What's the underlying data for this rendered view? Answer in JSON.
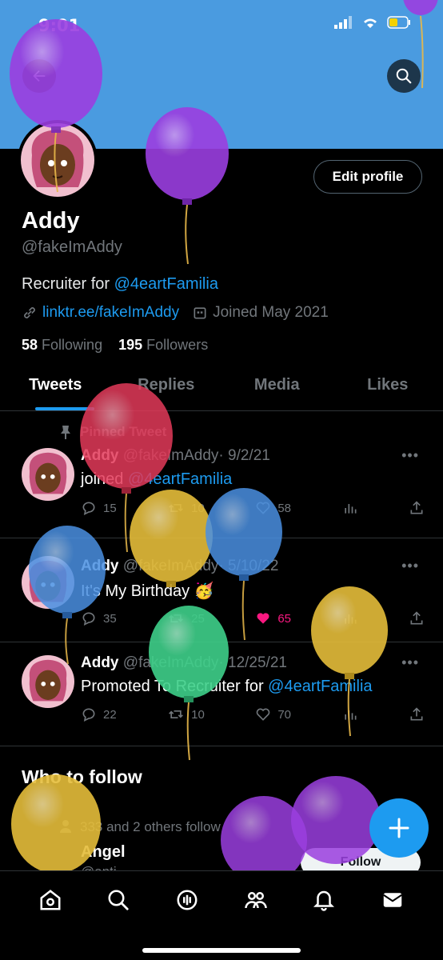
{
  "status": {
    "time": "9:01"
  },
  "header": {
    "back_icon": "arrow-left-icon",
    "search_icon": "search-icon"
  },
  "profile": {
    "name": "Addy",
    "handle": "@fakeImAddy",
    "bio_prefix": "Recruiter for ",
    "bio_mention": "@4eartFamilia",
    "link": "linktr.ee/fakeImAddy",
    "joined": "Joined May 2021",
    "following_count": "58",
    "following_label": "Following",
    "followers_count": "195",
    "followers_label": "Followers",
    "edit_label": "Edit profile"
  },
  "tabs": [
    {
      "label": "Tweets"
    },
    {
      "label": "Replies"
    },
    {
      "label": "Media"
    },
    {
      "label": "Likes"
    }
  ],
  "pinned_label": "Pinned Tweet",
  "tweets": [
    {
      "name": "Addy",
      "handle": "@fakeImAddy",
      "date": "· 9/2/21",
      "text_prefix": "joined ",
      "mention": "@4eartFamilia",
      "replies": "15",
      "retweets": "10",
      "likes": "58",
      "liked": false
    },
    {
      "name": "Addy",
      "handle": "@fakeImAddy",
      "date": "· 5/10/22",
      "text_prefix": "It's My Birthday 🥳",
      "mention": "",
      "replies": "35",
      "retweets": "25",
      "likes": "65",
      "liked": true
    },
    {
      "name": "Addy",
      "handle": "@fakeImAddy",
      "date": "· 12/25/21",
      "text_prefix": "Promoted To Recruiter for ",
      "mention": "@4eartFamilia",
      "replies": "22",
      "retweets": "10",
      "likes": "70",
      "liked": false
    }
  ],
  "who_to_follow": {
    "title": "Who to follow",
    "context": "333 and 2 others follow",
    "name": "Angel",
    "handle": "@anti...",
    "follow_label": "Follow"
  },
  "colors": {
    "accent": "#1d9bf0",
    "like": "#f91880",
    "banner": "#4a9be0"
  }
}
